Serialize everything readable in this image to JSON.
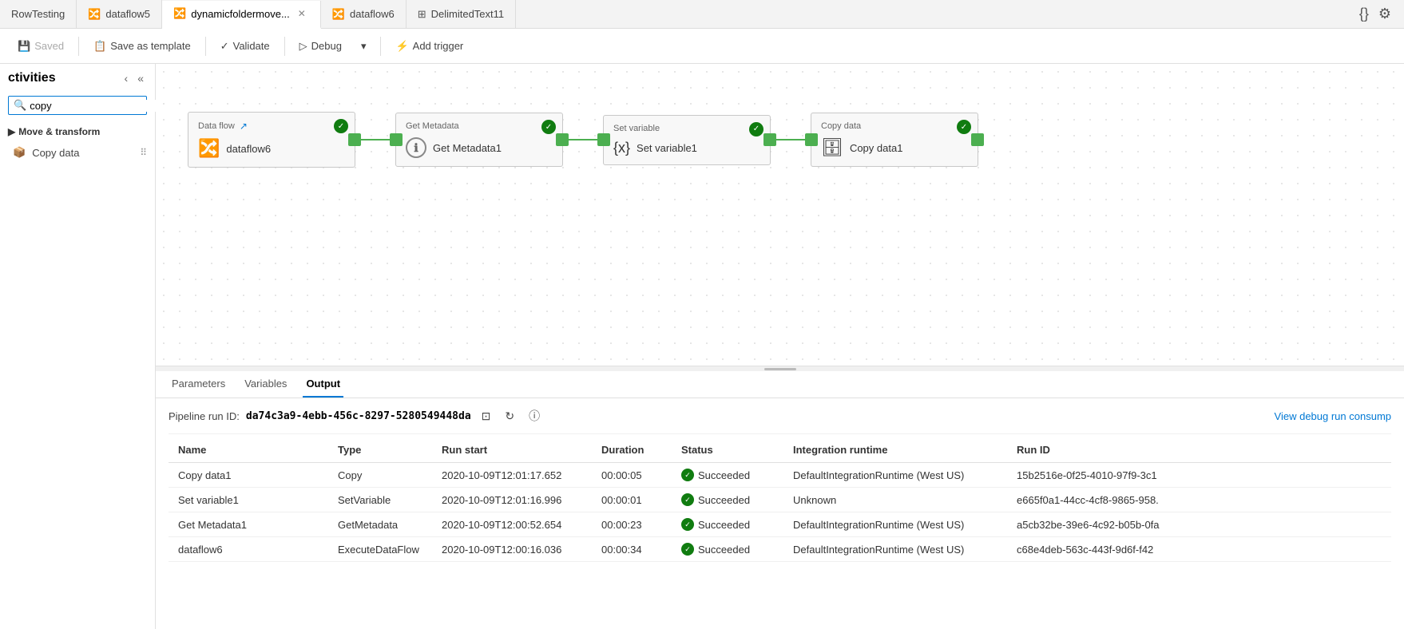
{
  "tabs": [
    {
      "id": "rowtesting",
      "label": "RowTesting",
      "icon": "",
      "active": false,
      "closable": false
    },
    {
      "id": "dataflow5",
      "label": "dataflow5",
      "icon": "dataflow",
      "active": false,
      "closable": false
    },
    {
      "id": "dynamicfoldermove",
      "label": "dynamicfoldermove...",
      "icon": "dataflow",
      "active": true,
      "closable": true
    },
    {
      "id": "dataflow6",
      "label": "dataflow6",
      "icon": "dataflow",
      "active": false,
      "closable": false
    },
    {
      "id": "delimitedtext11",
      "label": "DelimitedText11",
      "icon": "table",
      "active": false,
      "closable": false
    }
  ],
  "toolbar": {
    "saved_label": "Saved",
    "save_as_template_label": "Save as template",
    "validate_label": "Validate",
    "debug_label": "Debug",
    "add_trigger_label": "Add trigger"
  },
  "sidebar": {
    "title": "ctivities",
    "search_placeholder": "copy",
    "sections": [
      {
        "id": "move-transform",
        "label": "Move & transform",
        "items": [
          {
            "id": "copy-data",
            "label": "Copy data"
          }
        ]
      }
    ]
  },
  "pipeline": {
    "nodes": [
      {
        "id": "dataflow6-node",
        "type": "Data flow",
        "label": "dataflow6",
        "icon": "dataflow"
      },
      {
        "id": "get-metadata1-node",
        "type": "Get Metadata",
        "label": "Get Metadata1",
        "icon": "info"
      },
      {
        "id": "set-variable1-node",
        "type": "Set variable",
        "label": "Set variable1",
        "icon": "variable"
      },
      {
        "id": "copy-data1-node",
        "type": "Copy data",
        "label": "Copy data1",
        "icon": "copy"
      }
    ]
  },
  "bottom_panel": {
    "tabs": [
      {
        "id": "parameters",
        "label": "Parameters",
        "active": false
      },
      {
        "id": "variables",
        "label": "Variables",
        "active": false
      },
      {
        "id": "output",
        "label": "Output",
        "active": true
      }
    ],
    "pipeline_run_id_label": "Pipeline run ID:",
    "pipeline_run_id_value": "da74c3a9-4ebb-456c-8297-5280549448da",
    "view_debug_label": "View debug run consump",
    "table": {
      "columns": [
        "Name",
        "Type",
        "Run start",
        "Duration",
        "Status",
        "Integration runtime",
        "Run ID"
      ],
      "rows": [
        {
          "name": "Copy data1",
          "type": "Copy",
          "run_start": "2020-10-09T12:01:17.652",
          "duration": "00:00:05",
          "status": "Succeeded",
          "integration_runtime": "DefaultIntegrationRuntime (West US)",
          "run_id": "15b2516e-0f25-4010-97f9-3c1"
        },
        {
          "name": "Set variable1",
          "type": "SetVariable",
          "run_start": "2020-10-09T12:01:16.996",
          "duration": "00:00:01",
          "status": "Succeeded",
          "integration_runtime": "Unknown",
          "run_id": "e665f0a1-44cc-4cf8-9865-958."
        },
        {
          "name": "Get Metadata1",
          "type": "GetMetadata",
          "run_start": "2020-10-09T12:00:52.654",
          "duration": "00:00:23",
          "status": "Succeeded",
          "integration_runtime": "DefaultIntegrationRuntime (West US)",
          "run_id": "a5cb32be-39e6-4c92-b05b-0fa"
        },
        {
          "name": "dataflow6",
          "type": "ExecuteDataFlow",
          "run_start": "2020-10-09T12:00:16.036",
          "duration": "00:00:34",
          "status": "Succeeded",
          "integration_runtime": "DefaultIntegrationRuntime (West US)",
          "run_id": "c68e4deb-563c-443f-9d6f-f42"
        }
      ]
    }
  }
}
